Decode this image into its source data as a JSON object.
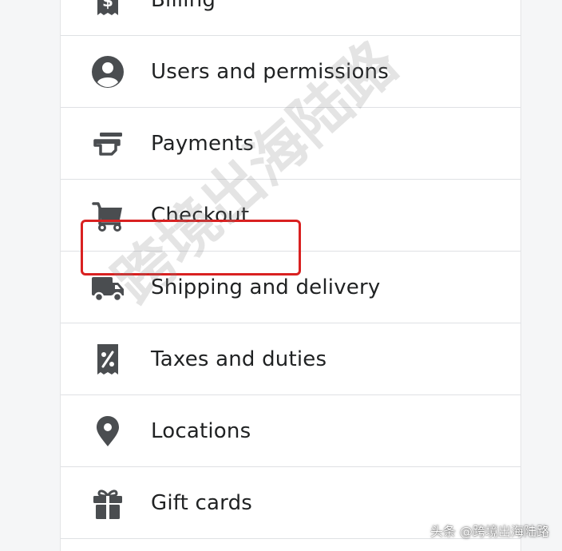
{
  "settings_menu": {
    "items": [
      {
        "label": "Billing",
        "icon": "billing-receipt-icon"
      },
      {
        "label": "Users and permissions",
        "icon": "user-avatar-icon"
      },
      {
        "label": "Payments",
        "icon": "payment-cards-icon"
      },
      {
        "label": "Checkout",
        "icon": "shopping-cart-icon"
      },
      {
        "label": "Shipping and delivery",
        "icon": "truck-icon"
      },
      {
        "label": "Taxes and duties",
        "icon": "tax-percent-receipt-icon"
      },
      {
        "label": "Locations",
        "icon": "map-pin-icon"
      },
      {
        "label": "Gift cards",
        "icon": "gift-icon"
      }
    ],
    "highlighted_item": "Checkout"
  },
  "overlay": {
    "watermark_text": "跨境出海陆路",
    "source_credit": "头条 @跨境出海陆路",
    "highlight_color": "#d92121"
  },
  "colors": {
    "icon": "#4a4d50",
    "text": "#202223",
    "divider": "#dfe1e4"
  }
}
